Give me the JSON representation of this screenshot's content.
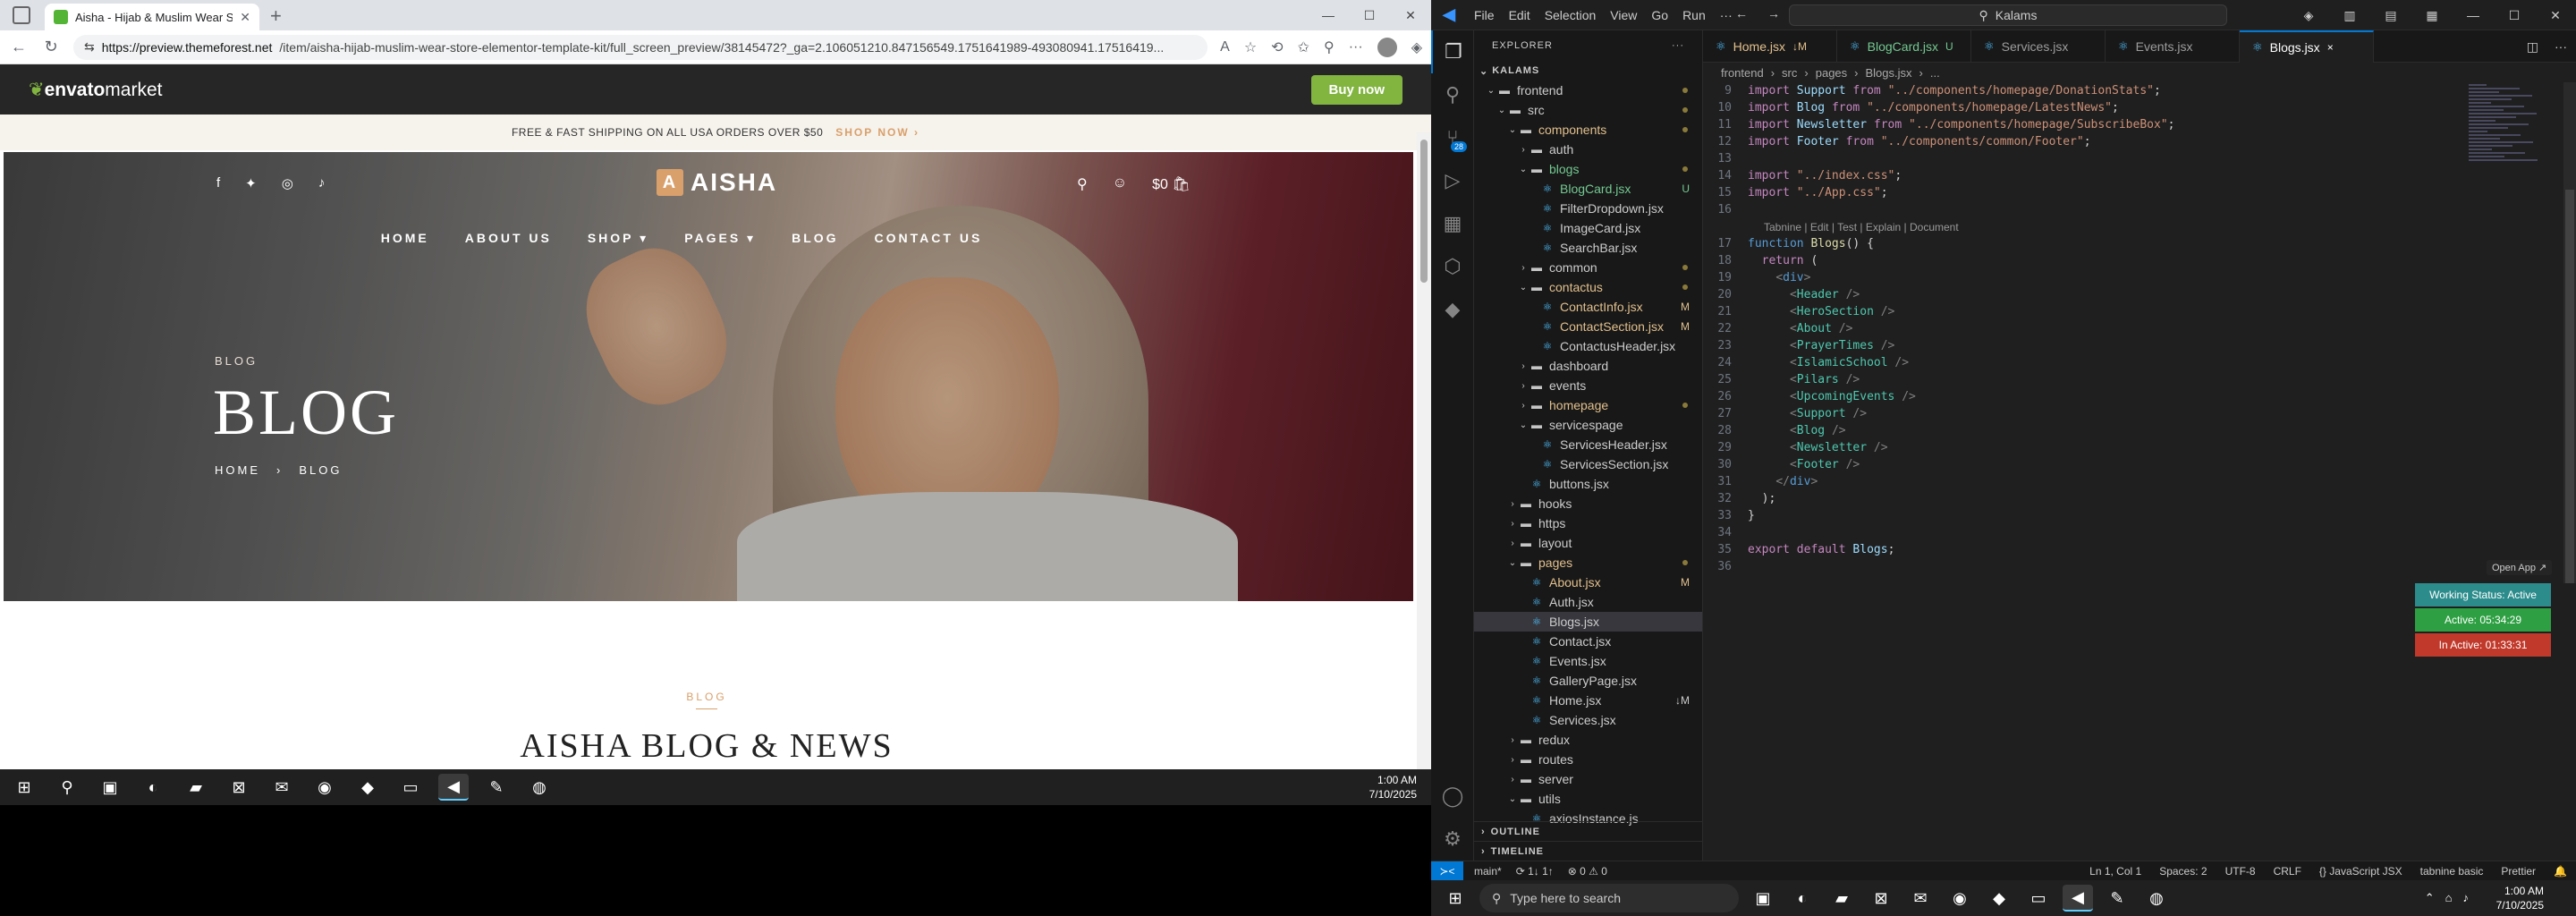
{
  "browser": {
    "tab_title": "Aisha - Hijab & Muslim Wear Sto...",
    "url_host": "https://preview.themeforest.net",
    "url_path": "/item/aisha-hijab-muslim-wear-store-elementor-template-kit/full_screen_preview/38145472?_ga=2.106051210.847156549.1751641989-493080941.17516419...",
    "newtab": "+",
    "envato_logo": "envato",
    "envato_logo_suffix": "market",
    "buy_now": "Buy now",
    "shipping": "FREE & FAST SHIPPING ON ALL USA ORDERS OVER $50",
    "shop_now": "SHOP NOW  ›",
    "brand": "AISHA",
    "brand_mark": "A",
    "cart": "$0",
    "menu": [
      "HOME",
      "ABOUT US",
      "SHOP ▾",
      "PAGES ▾",
      "BLOG",
      "CONTACT US"
    ],
    "eyebrow": "BLOG",
    "hero_title": "BLOG",
    "crumb_home": "HOME",
    "crumb_sep": "›",
    "crumb_current": "BLOG",
    "section_tag": "BLOG",
    "section_title": "AISHA BLOG & NEWS"
  },
  "taskbar_left": {
    "time": "1:00 AM",
    "date": "7/10/2025"
  },
  "vscode": {
    "menu": [
      "File",
      "Edit",
      "Selection",
      "View",
      "Go",
      "Run",
      "···"
    ],
    "search": "Kalams",
    "explorer_title": "EXPLORER",
    "project": "KALAMS",
    "tree": [
      {
        "label": "frontend",
        "depth": 1,
        "type": "open",
        "dot": true
      },
      {
        "label": "src",
        "depth": 2,
        "type": "open",
        "dot": true
      },
      {
        "label": "components",
        "depth": 3,
        "type": "open",
        "dot": true,
        "cls": "c-mod"
      },
      {
        "label": "auth",
        "depth": 4,
        "type": "closed"
      },
      {
        "label": "blogs",
        "depth": 4,
        "type": "open",
        "dot": true,
        "cls": "c-unt"
      },
      {
        "label": "BlogCard.jsx",
        "depth": 5,
        "type": "file",
        "status": "U",
        "cls": "c-unt"
      },
      {
        "label": "FilterDropdown.jsx",
        "depth": 5,
        "type": "file"
      },
      {
        "label": "ImageCard.jsx",
        "depth": 5,
        "type": "file"
      },
      {
        "label": "SearchBar.jsx",
        "depth": 5,
        "type": "file"
      },
      {
        "label": "common",
        "depth": 4,
        "type": "closed",
        "dot": true
      },
      {
        "label": "contactus",
        "depth": 4,
        "type": "open",
        "dot": true,
        "cls": "c-mod"
      },
      {
        "label": "ContactInfo.jsx",
        "depth": 5,
        "type": "file",
        "status": "M",
        "cls": "c-mod"
      },
      {
        "label": "ContactSection.jsx",
        "depth": 5,
        "type": "file",
        "status": "M",
        "cls": "c-mod"
      },
      {
        "label": "ContactusHeader.jsx",
        "depth": 5,
        "type": "file"
      },
      {
        "label": "dashboard",
        "depth": 4,
        "type": "closed"
      },
      {
        "label": "events",
        "depth": 4,
        "type": "closed"
      },
      {
        "label": "homepage",
        "depth": 4,
        "type": "closed",
        "dot": true,
        "cls": "c-mod"
      },
      {
        "label": "servicespage",
        "depth": 4,
        "type": "open"
      },
      {
        "label": "ServicesHeader.jsx",
        "depth": 5,
        "type": "file"
      },
      {
        "label": "ServicesSection.jsx",
        "depth": 5,
        "type": "file"
      },
      {
        "label": "buttons.jsx",
        "depth": 4,
        "type": "file"
      },
      {
        "label": "hooks",
        "depth": 3,
        "type": "closed"
      },
      {
        "label": "https",
        "depth": 3,
        "type": "closed"
      },
      {
        "label": "layout",
        "depth": 3,
        "type": "closed"
      },
      {
        "label": "pages",
        "depth": 3,
        "type": "open",
        "dot": true,
        "cls": "c-mod"
      },
      {
        "label": "About.jsx",
        "depth": 4,
        "type": "file",
        "status": "M",
        "cls": "c-mod"
      },
      {
        "label": "Auth.jsx",
        "depth": 4,
        "type": "file"
      },
      {
        "label": "Blogs.jsx",
        "depth": 4,
        "type": "file",
        "sel": true
      },
      {
        "label": "Contact.jsx",
        "depth": 4,
        "type": "file"
      },
      {
        "label": "Events.jsx",
        "depth": 4,
        "type": "file"
      },
      {
        "label": "GalleryPage.jsx",
        "depth": 4,
        "type": "file"
      },
      {
        "label": "Home.jsx",
        "depth": 4,
        "type": "file",
        "status": "↓M"
      },
      {
        "label": "Services.jsx",
        "depth": 4,
        "type": "file"
      },
      {
        "label": "redux",
        "depth": 3,
        "type": "closed"
      },
      {
        "label": "routes",
        "depth": 3,
        "type": "closed"
      },
      {
        "label": "server",
        "depth": 3,
        "type": "closed"
      },
      {
        "label": "utils",
        "depth": 3,
        "type": "open"
      },
      {
        "label": "axiosInstance.js",
        "depth": 4,
        "type": "file"
      }
    ],
    "outline": "OUTLINE",
    "timeline": "TIMELINE",
    "tabs": [
      {
        "label": "Home.jsx",
        "status": "↓M",
        "cls": "c-mod"
      },
      {
        "label": "BlogCard.jsx",
        "status": "U",
        "cls": "c-unt"
      },
      {
        "label": "Services.jsx",
        "status": ""
      },
      {
        "label": "Events.jsx",
        "status": ""
      },
      {
        "label": "Blogs.jsx",
        "status": "×",
        "on": true
      }
    ],
    "breadcrumb": [
      "frontend",
      "›",
      "src",
      "›",
      "pages",
      "›",
      "Blogs.jsx",
      "›",
      "..."
    ],
    "code_lines": [
      {
        "n": "9",
        "html": "<span class='kw'>import</span> <span class='var'>Support</span> <span class='kw'>from</span> <span class='str'>\"../components/homepage/DonationStats\"</span>;"
      },
      {
        "n": "10",
        "html": "<span class='kw'>import</span> <span class='var'>Blog</span> <span class='kw'>from</span> <span class='str'>\"../components/homepage/LatestNews\"</span>;"
      },
      {
        "n": "11",
        "html": "<span class='kw'>import</span> <span class='var'>Newsletter</span> <span class='kw'>from</span> <span class='str'>\"../components/homepage/SubscribeBox\"</span>;"
      },
      {
        "n": "12",
        "html": "<span class='kw'>import</span> <span class='var'>Footer</span> <span class='kw'>from</span> <span class='str'>\"../components/common/Footer\"</span>;"
      },
      {
        "n": "13",
        "html": ""
      },
      {
        "n": "14",
        "html": "<span class='kw'>import</span> <span class='str'>\"../index.css\"</span>;"
      },
      {
        "n": "15",
        "html": "<span class='kw'>import</span> <span class='str'>\"../App.css\"</span>;"
      },
      {
        "n": "16",
        "html": ""
      },
      {
        "lens": "Tabnine | Edit | Test | Explain | Document"
      },
      {
        "n": "17",
        "html": "<span class='kb'>function</span> <span class='fn'>Blogs</span>() {"
      },
      {
        "n": "18",
        "html": "  <span class='kw'>return</span> ("
      },
      {
        "n": "19",
        "html": "    <span class='br'>&lt;</span><span class='kb'>div</span><span class='br'>&gt;</span>"
      },
      {
        "n": "20",
        "html": "      <span class='br'>&lt;</span><span class='tag'>Header</span> <span class='br'>/&gt;</span>"
      },
      {
        "n": "21",
        "html": "      <span class='br'>&lt;</span><span class='tag'>HeroSection</span> <span class='br'>/&gt;</span>"
      },
      {
        "n": "22",
        "html": "      <span class='br'>&lt;</span><span class='tag'>About</span> <span class='br'>/&gt;</span>"
      },
      {
        "n": "23",
        "html": "      <span class='br'>&lt;</span><span class='tag'>PrayerTimes</span> <span class='br'>/&gt;</span>"
      },
      {
        "n": "24",
        "html": "      <span class='br'>&lt;</span><span class='tag'>IslamicSchool</span> <span class='br'>/&gt;</span>"
      },
      {
        "n": "25",
        "html": "      <span class='br'>&lt;</span><span class='tag'>Pilars</span> <span class='br'>/&gt;</span>"
      },
      {
        "n": "26",
        "html": "      <span class='br'>&lt;</span><span class='tag'>UpcomingEvents</span> <span class='br'>/&gt;</span>"
      },
      {
        "n": "27",
        "html": "      <span class='br'>&lt;</span><span class='tag'>Support</span> <span class='br'>/&gt;</span>"
      },
      {
        "n": "28",
        "html": "      <span class='br'>&lt;</span><span class='tag'>Blog</span> <span class='br'>/&gt;</span>"
      },
      {
        "n": "29",
        "html": "      <span class='br'>&lt;</span><span class='tag'>Newsletter</span> <span class='br'>/&gt;</span>"
      },
      {
        "n": "30",
        "html": "      <span class='br'>&lt;</span><span class='tag'>Footer</span> <span class='br'>/&gt;</span>"
      },
      {
        "n": "31",
        "html": "    <span class='br'>&lt;/</span><span class='kb'>div</span><span class='br'>&gt;</span>"
      },
      {
        "n": "32",
        "html": "  );"
      },
      {
        "n": "33",
        "html": "}"
      },
      {
        "n": "34",
        "html": ""
      },
      {
        "n": "35",
        "html": "<span class='kw'>export</span> <span class='kw'>default</span> <span class='var'>Blogs</span>;"
      },
      {
        "n": "36",
        "html": ""
      }
    ],
    "open_app": "Open App ↗",
    "working_status": "Working Status: Active",
    "active_time": "Active: 05:34:29",
    "inactive_time": "In Active: 01:33:31",
    "status_left": [
      "main*",
      "⟳ 1↓ 1↑",
      "⊗ 0 ⚠ 0"
    ],
    "status_right": [
      "Ln 1, Col 1",
      "Spaces: 2",
      "UTF-8",
      "CRLF",
      "{} JavaScript JSX",
      "tabnine basic",
      "Prettier"
    ],
    "colors": {
      "accent": "#0078d4",
      "active_green": "#2ea043",
      "inactive_red": "#c0392b",
      "working_teal": "#2c8c8c"
    }
  },
  "taskbar_right": {
    "search_placeholder": "Type here to search",
    "time": "1:00 AM",
    "date": "7/10/2025"
  }
}
